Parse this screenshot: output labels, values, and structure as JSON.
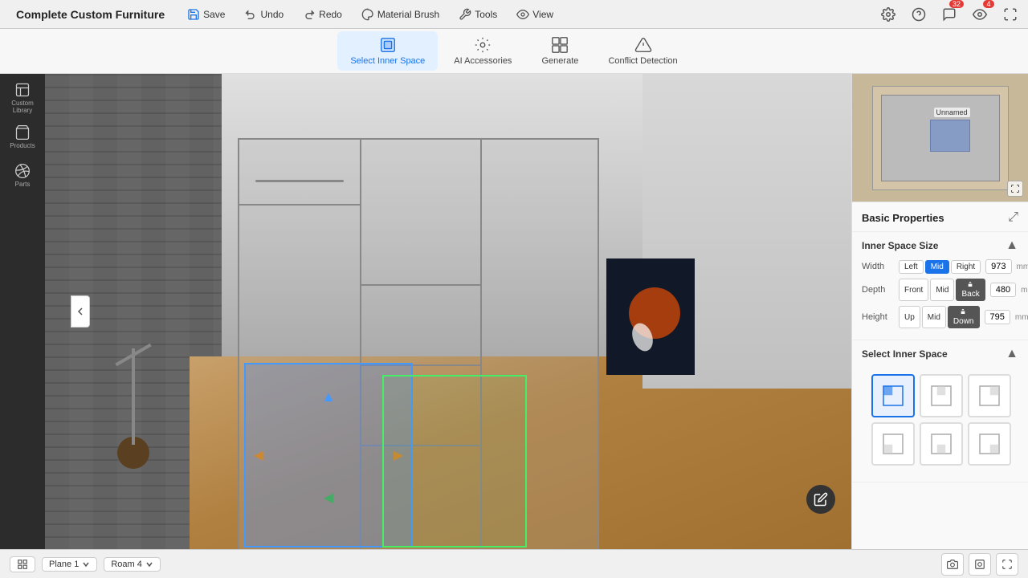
{
  "topbar": {
    "back_label": "←",
    "title": "Complete Custom Furniture",
    "save": "Save",
    "undo": "Undo",
    "redo": "Redo",
    "material_brush": "Material Brush",
    "tools": "Tools",
    "view": "View",
    "view_badge": "4",
    "message_badge": "32"
  },
  "toolbar": {
    "select_inner_space": "Select Inner Space",
    "ai_accessories": "AI Accessories",
    "generate": "Generate",
    "conflict_detection": "Conflict Detection"
  },
  "left_nav": {
    "items": [
      {
        "id": "custom-library",
        "label": "Custom Library"
      },
      {
        "id": "products",
        "label": "Products"
      },
      {
        "id": "parts",
        "label": "Parts"
      }
    ]
  },
  "right_panel": {
    "basic_properties": "Basic Properties",
    "inner_space_size": "Inner Space Size",
    "width_label": "Width",
    "width_left": "Left",
    "width_mid": "Mid",
    "width_right": "Right",
    "width_value": "973",
    "width_unit": "mm",
    "depth_label": "Depth",
    "depth_front": "Front",
    "depth_mid": "Mid",
    "depth_back": "Back",
    "depth_value": "480",
    "depth_unit": "mm",
    "height_label": "Height",
    "height_up": "Up",
    "height_mid": "Mid",
    "height_down": "Down",
    "height_value": "795",
    "height_unit": "mm",
    "select_inner_space": "Select Inner Space",
    "space_cells": [
      {
        "id": "front-left",
        "active": true
      },
      {
        "id": "front-mid",
        "active": false
      },
      {
        "id": "front-right",
        "active": false
      },
      {
        "id": "back-left",
        "active": false
      },
      {
        "id": "back-mid",
        "active": false
      },
      {
        "id": "back-right",
        "active": false
      }
    ]
  },
  "bottom_bar": {
    "plane_label": "Plane 1",
    "room_label": "Roam 4"
  },
  "colors": {
    "active_blue": "#1a73e8",
    "selection_blue": "rgba(100,160,255,0.35)",
    "green_box": "#44ee66"
  }
}
